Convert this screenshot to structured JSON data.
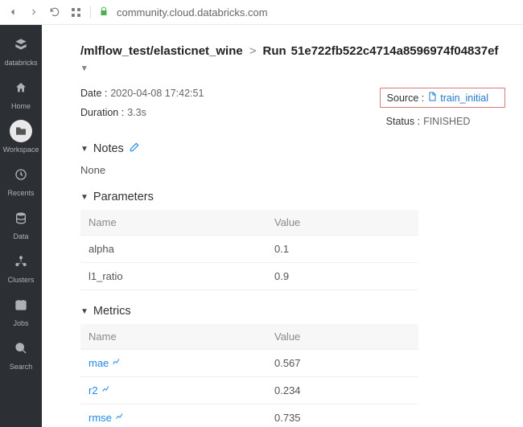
{
  "browser": {
    "url": "community.cloud.databricks.com"
  },
  "sidebar": {
    "items": [
      {
        "label": "databricks"
      },
      {
        "label": "Home"
      },
      {
        "label": "Workspace"
      },
      {
        "label": "Recents"
      },
      {
        "label": "Data"
      },
      {
        "label": "Clusters"
      },
      {
        "label": "Jobs"
      },
      {
        "label": "Search"
      }
    ]
  },
  "breadcrumb": {
    "path": "/mlflow_test/elasticnet_wine",
    "run_prefix": "Run",
    "run_id": "51e722fb522c4714a8596974f04837ef"
  },
  "meta": {
    "date_label": "Date :",
    "date_value": "2020-04-08 17:42:51",
    "duration_label": "Duration :",
    "duration_value": "3.3s",
    "source_label": "Source :",
    "source_value": "train_initial",
    "status_label": "Status :",
    "status_value": "FINISHED"
  },
  "notes": {
    "title": "Notes",
    "body": "None"
  },
  "parameters": {
    "title": "Parameters",
    "headers": {
      "name": "Name",
      "value": "Value"
    },
    "rows": [
      {
        "name": "alpha",
        "value": "0.1"
      },
      {
        "name": "l1_ratio",
        "value": "0.9"
      }
    ]
  },
  "metrics": {
    "title": "Metrics",
    "headers": {
      "name": "Name",
      "value": "Value"
    },
    "rows": [
      {
        "name": "mae",
        "value": "0.567"
      },
      {
        "name": "r2",
        "value": "0.234"
      },
      {
        "name": "rmse",
        "value": "0.735"
      }
    ]
  }
}
